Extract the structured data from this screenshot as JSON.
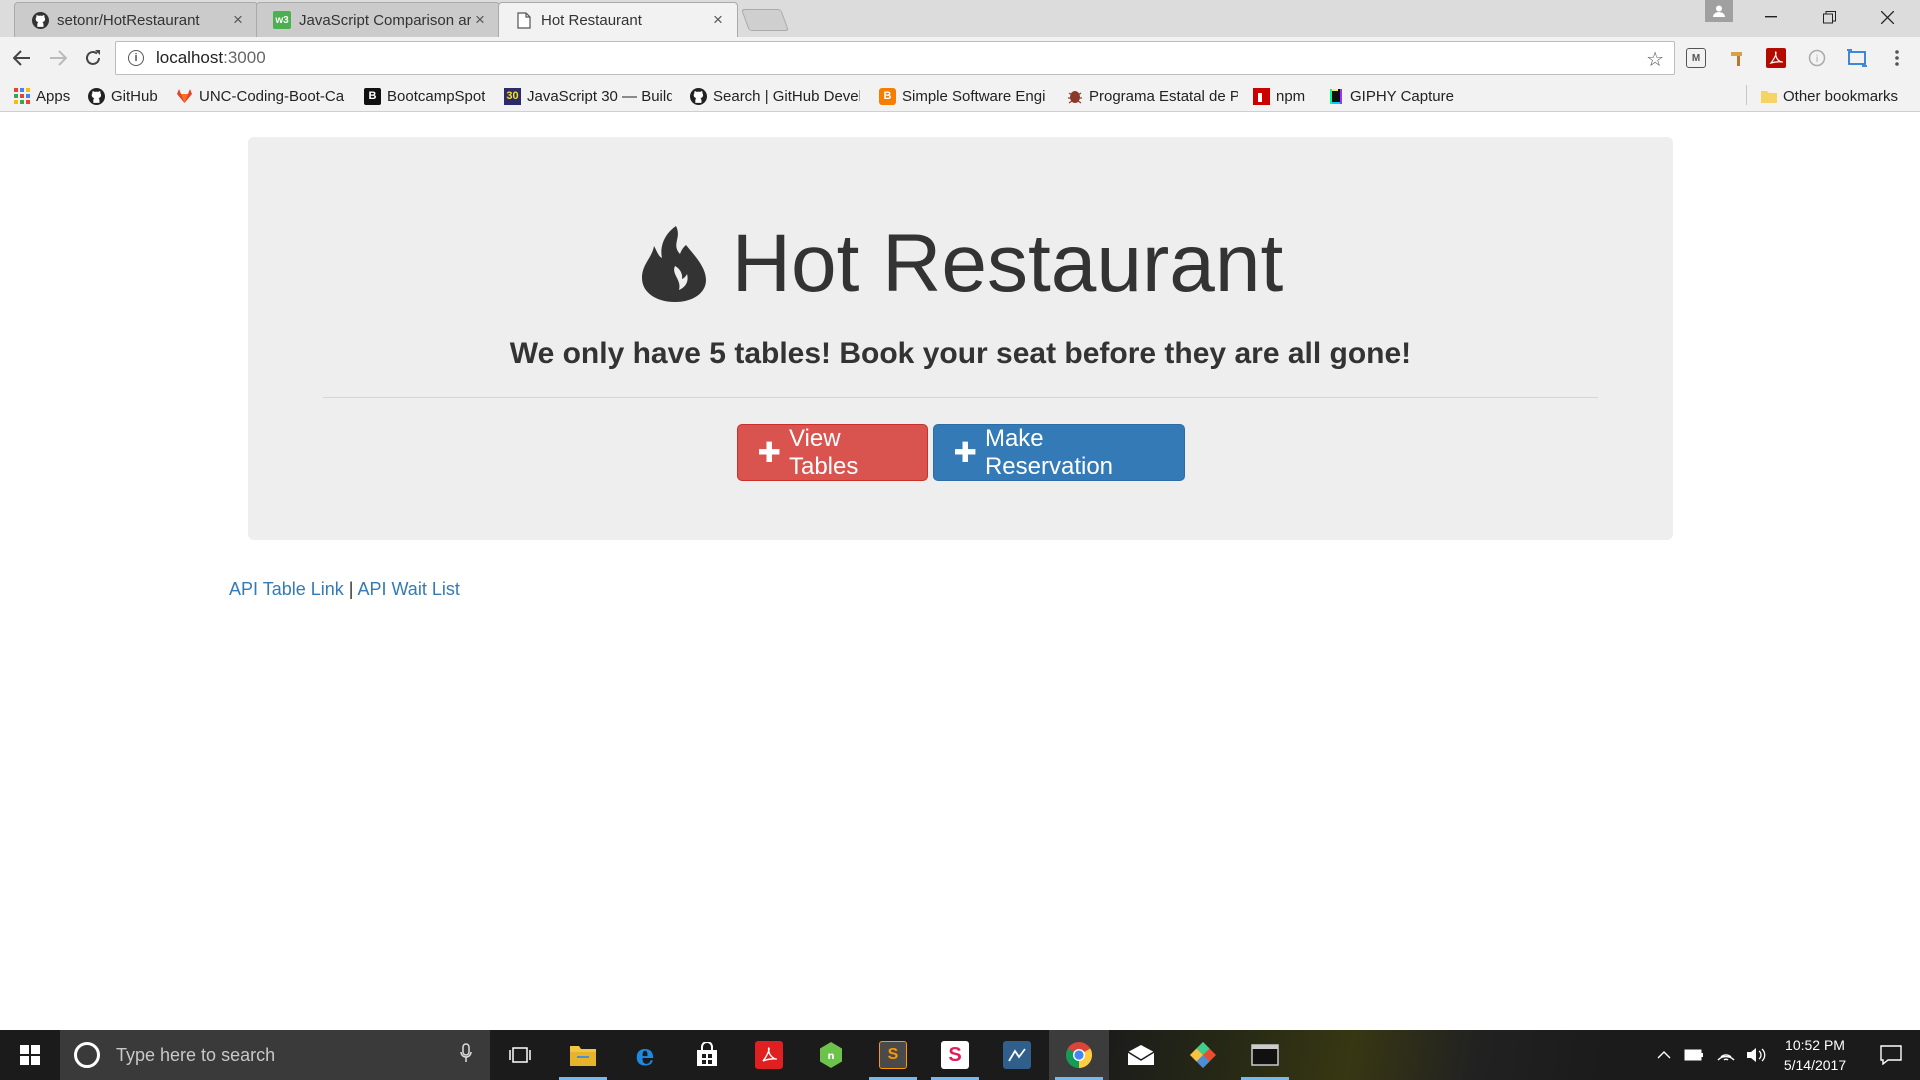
{
  "browser": {
    "tabs": [
      {
        "title": "setonr/HotRestaurant",
        "icon": "github-icon",
        "active": false
      },
      {
        "title": "JavaScript Comparison ar",
        "icon": "w3schools-icon",
        "active": false
      },
      {
        "title": "Hot Restaurant",
        "icon": "page-icon",
        "active": true
      }
    ],
    "url_host": "localhost",
    "url_port": ":3000",
    "bookmarks": [
      {
        "label": "Apps",
        "icon": "apps-grid-icon"
      },
      {
        "label": "GitHub",
        "icon": "github-icon"
      },
      {
        "label": "UNC-Coding-Boot-Ca",
        "icon": "gitlab-icon"
      },
      {
        "label": "BootcampSpot",
        "icon": "bootcampspot-icon"
      },
      {
        "label": "JavaScript 30 — Build",
        "icon": "javascript30-icon"
      },
      {
        "label": "Search | GitHub Devel",
        "icon": "github-icon"
      },
      {
        "label": "Simple Software Engi",
        "icon": "blogger-icon"
      },
      {
        "label": "Programa Estatal de P",
        "icon": "bug-icon"
      },
      {
        "label": "npm",
        "icon": "npm-icon"
      },
      {
        "label": "GIPHY Capture",
        "icon": "giphy-icon"
      }
    ],
    "other_bookmarks": "Other bookmarks"
  },
  "page": {
    "title": "Hot Restaurant",
    "tagline": "We only have 5 tables! Book your seat before they are all gone!",
    "view_tables_label": "View Tables",
    "make_reservation_label": "Make Reservation",
    "api_table_link": "API Table Link",
    "link_separator": "|",
    "api_wait_list": "API Wait List"
  },
  "taskbar": {
    "search_placeholder": "Type here to search",
    "time": "10:52 PM",
    "date": "5/14/2017"
  },
  "colors": {
    "danger": "#d9534f",
    "primary": "#337ab7",
    "jumbotron": "#eeeeee"
  }
}
